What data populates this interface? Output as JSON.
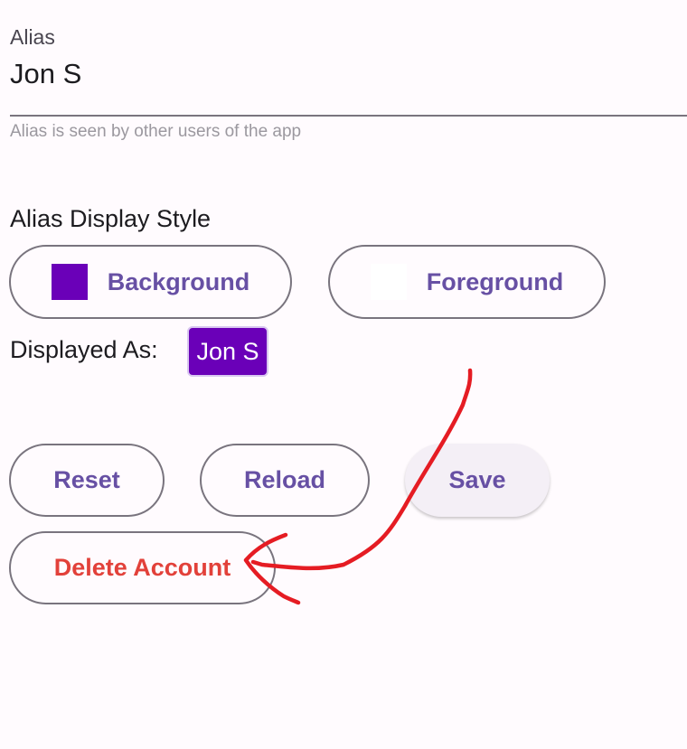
{
  "alias_field": {
    "label": "Alias",
    "value": "Jon S",
    "helper": "Alias is seen by other users of the app"
  },
  "display_style": {
    "title": "Alias Display Style",
    "background_label": "Background",
    "background_color": "#6a00b8",
    "foreground_label": "Foreground",
    "foreground_color": "#ffffff"
  },
  "preview": {
    "label": "Displayed As:",
    "text": "Jon S"
  },
  "actions": {
    "reset_label": "Reset",
    "reload_label": "Reload",
    "save_label": "Save",
    "delete_label": "Delete Account"
  },
  "colors": {
    "primary_text": "#6750a4",
    "danger_text": "#e2413a",
    "annotation_stroke": "#e51c23"
  }
}
